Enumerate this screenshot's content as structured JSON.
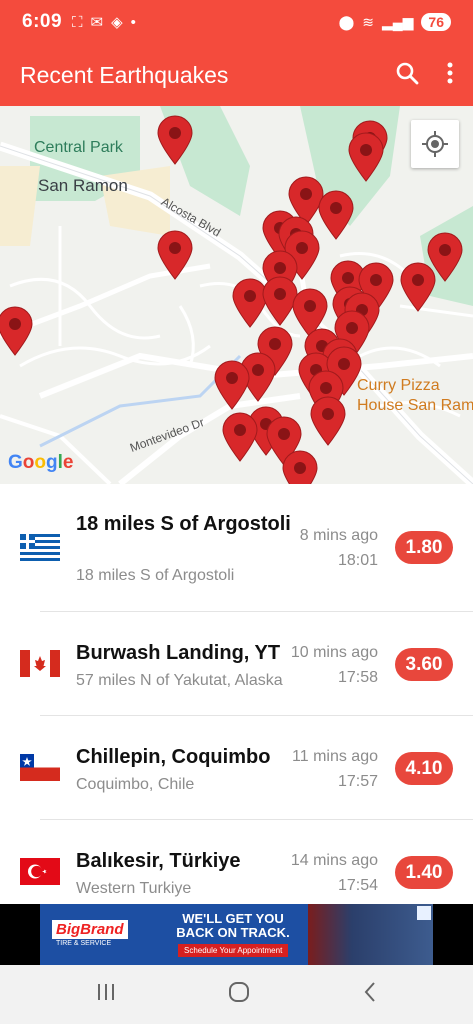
{
  "status_bar": {
    "time": "6:09",
    "battery": "76"
  },
  "app_bar": {
    "title": "Recent Earthquakes"
  },
  "map": {
    "labels": {
      "central_park": "Central Park",
      "san_ramon": "San Ramon",
      "alcosta_blvd": "Alcosta Blvd",
      "montevideo_dr": "Montevideo Dr",
      "curry_pizza": "Curry Pizza",
      "curry_pizza_2": "House San Ram"
    },
    "google": "Google"
  },
  "quakes": [
    {
      "flag": "greece-flag",
      "title": "18 miles S of Argostoli",
      "subtitle": "18 miles S of Argostoli",
      "ago": "8 mins ago",
      "time": "18:01",
      "magnitude": "1.80"
    },
    {
      "flag": "canada-flag",
      "title": "Burwash Landing, YT",
      "subtitle": "57 miles N of Yakutat, Alaska",
      "ago": "10 mins ago",
      "time": "17:58",
      "magnitude": "3.60"
    },
    {
      "flag": "chile-flag",
      "title": "Chillepin, Coquimbo",
      "subtitle": "Coquimbo, Chile",
      "ago": "11 mins ago",
      "time": "17:57",
      "magnitude": "4.10"
    },
    {
      "flag": "turkey-flag",
      "title": "Balıkesir, Türkiye",
      "subtitle": "Western Turkiye",
      "ago": "14 mins ago",
      "time": "17:54",
      "magnitude": "1.40"
    }
  ],
  "ad": {
    "brand": "BigBrand",
    "brand_sub": "TIRE & SERVICE",
    "headline": "WE'LL GET YOU BACK ON TRACK.",
    "cta": "Schedule Your Appointment"
  },
  "colors": {
    "accent": "#f44b3d",
    "pin": "#d8282a",
    "badge": "#e8473c"
  }
}
